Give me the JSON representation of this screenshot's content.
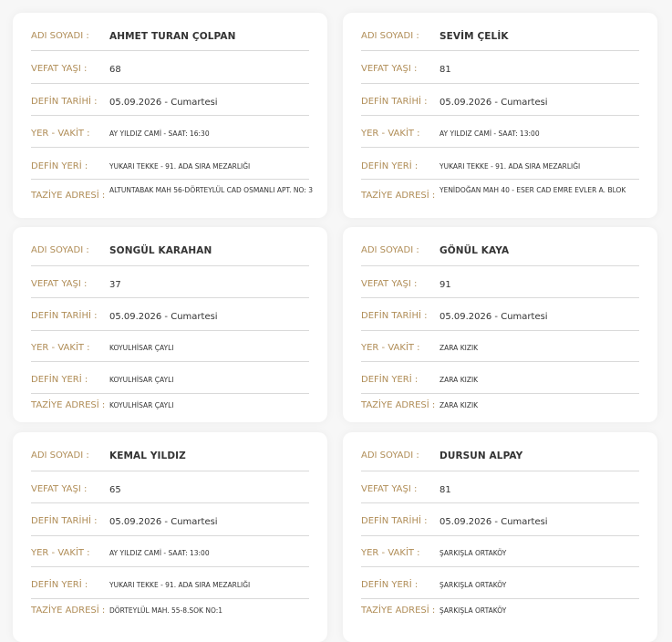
{
  "labels": {
    "name": "ADI SOYADI :",
    "age": "VEFAT YAŞI :",
    "burial_date": "DEFİN TARİHİ :",
    "place_time": "YER - VAKİT :",
    "burial_place": "DEFİN YERİ :",
    "condolence_address": "TAZİYE ADRESİ :"
  },
  "records": [
    {
      "name": "AHMET TURAN ÇOLPAN",
      "age": "68",
      "burial_date": "05.09.2026 - Cumartesi",
      "place_time": "AY YILDIZ CAMİ - SAAT: 16:30",
      "burial_place": "YUKARI TEKKE - 91. ADA SIRA MEZARLIĞI",
      "condolence_address": "ALTUNTABAK MAH 56-DÖRTEYLÜL CAD OSMANLI APT. NO: 3"
    },
    {
      "name": "SEVİM ÇELİK",
      "age": "81",
      "burial_date": "05.09.2026 - Cumartesi",
      "place_time": "AY YILDIZ CAMİ - SAAT: 13:00",
      "burial_place": "YUKARI TEKKE - 91. ADA SIRA MEZARLIĞI",
      "condolence_address": "YENİDOĞAN MAH 40 - ESER CAD EMRE EVLER A. BLOK"
    },
    {
      "name": "SONGÜL KARAHAN",
      "age": "37",
      "burial_date": "05.09.2026 - Cumartesi",
      "place_time": "KOYULHİSAR ÇAYLI",
      "burial_place": "KOYULHİSAR ÇAYLI",
      "condolence_address": "KOYULHİSAR ÇAYLI"
    },
    {
      "name": "GÖNÜL KAYA",
      "age": "91",
      "burial_date": "05.09.2026 - Cumartesi",
      "place_time": "ZARA KIZIK",
      "burial_place": "ZARA KIZIK",
      "condolence_address": "ZARA KIZIK"
    },
    {
      "name": "KEMAL YILDIZ",
      "age": "65",
      "burial_date": "05.09.2026 - Cumartesi",
      "place_time": "AY YILDIZ CAMİ - SAAT: 13:00",
      "burial_place": "YUKARI TEKKE - 91. ADA SIRA MEZARLIĞI",
      "condolence_address": "DÖRTEYLÜL MAH. 55-8.SOK NO:1"
    },
    {
      "name": "DURSUN ALPAY",
      "age": "81",
      "burial_date": "05.09.2026 - Cumartesi",
      "place_time": "ŞARKIŞLA ORTAKÖY",
      "burial_place": "ŞARKIŞLA ORTAKÖY",
      "condolence_address": "ŞARKIŞLA ORTAKÖY"
    }
  ]
}
